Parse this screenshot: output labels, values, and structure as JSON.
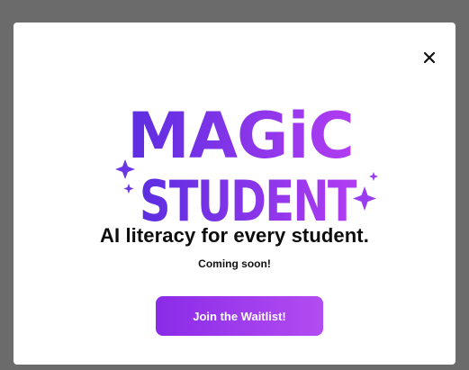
{
  "modal": {
    "logo_line1": "MAGiC",
    "logo_line2": "STUDENT",
    "headline": "AI literacy for every student.",
    "subheadline": "Coming soon!",
    "cta_label": "Join the Waitlist!"
  },
  "icons": {
    "close": "close-icon",
    "sparkle": "sparkle-icon"
  },
  "colors": {
    "backdrop": "#6b6b6b",
    "logo_gradient_start": "#5b2ee0",
    "logo_gradient_end": "#b23cf2",
    "sparkle": "#6c35e6",
    "cta_start": "#8a2be8",
    "cta_end": "#b34cf0",
    "headline": "#0d0d0d"
  }
}
